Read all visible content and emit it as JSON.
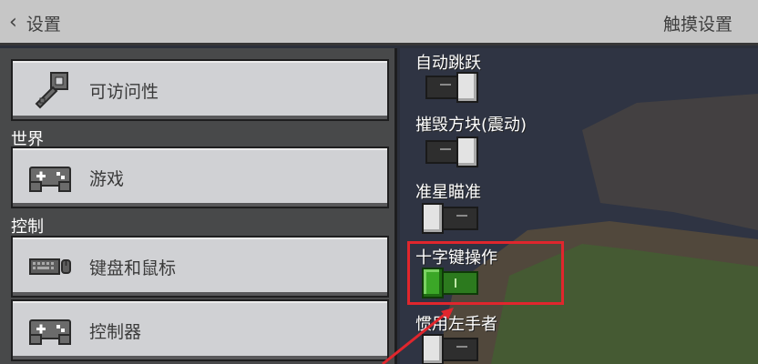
{
  "header": {
    "back_label": "设置",
    "right_title": "触摸设置"
  },
  "sidebar": {
    "items": [
      {
        "label": "可访问性",
        "icon": "key-icon"
      },
      {
        "section": "世界"
      },
      {
        "label": "游戏",
        "icon": "gamepad-icon"
      },
      {
        "section": "控制"
      },
      {
        "label": "键盘和鼠标",
        "icon": "keyboard-mouse-icon"
      },
      {
        "label": "控制器",
        "icon": "gamepad-icon"
      }
    ]
  },
  "settings": {
    "options": [
      {
        "label": "自动跳跃",
        "enabled": false
      },
      {
        "label": "摧毁方块(震动)",
        "enabled": false
      },
      {
        "label": "准星瞄准",
        "enabled": false
      },
      {
        "label": "十字键操作",
        "enabled": true
      },
      {
        "label": "惯用左手者",
        "enabled": false
      }
    ]
  },
  "colors": {
    "highlight": "#e0262d",
    "toggle_on": "#3ba727",
    "panel_bg": "#48494a",
    "button_bg": "#d0d1d4"
  }
}
